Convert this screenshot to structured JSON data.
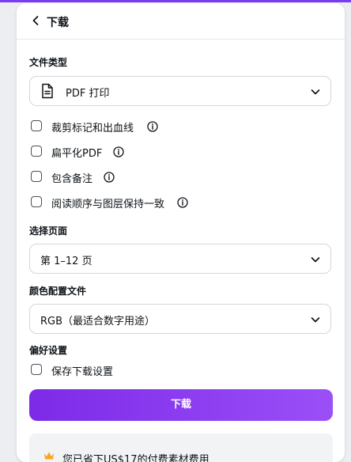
{
  "header": {
    "title": "下载"
  },
  "file_type": {
    "label": "文件类型",
    "value": "PDF 打印"
  },
  "pdf_options": [
    {
      "label": "裁剪标记和出血线",
      "checked": false,
      "has_info": true
    },
    {
      "label": "扁平化PDF",
      "checked": false,
      "has_info": true
    },
    {
      "label": "包含备注",
      "checked": false,
      "has_info": true
    },
    {
      "label": "阅读顺序与图层保持一致",
      "checked": false,
      "has_info": true
    }
  ],
  "pages": {
    "label": "选择页面",
    "value": "第 1–12 页"
  },
  "color_profile": {
    "label": "颜色配置文件",
    "value": "RGB（最适合数字用途）"
  },
  "preferences": {
    "label": "偏好设置",
    "save_label": "保存下载设置",
    "checked": false
  },
  "download_button": {
    "label": "下载"
  },
  "savings": {
    "text": "您已省下US$17的付费素材费用"
  },
  "colors": {
    "accent": "#7d2ae8",
    "accent_light": "#9a4ff7",
    "crown": "#f5a623"
  }
}
